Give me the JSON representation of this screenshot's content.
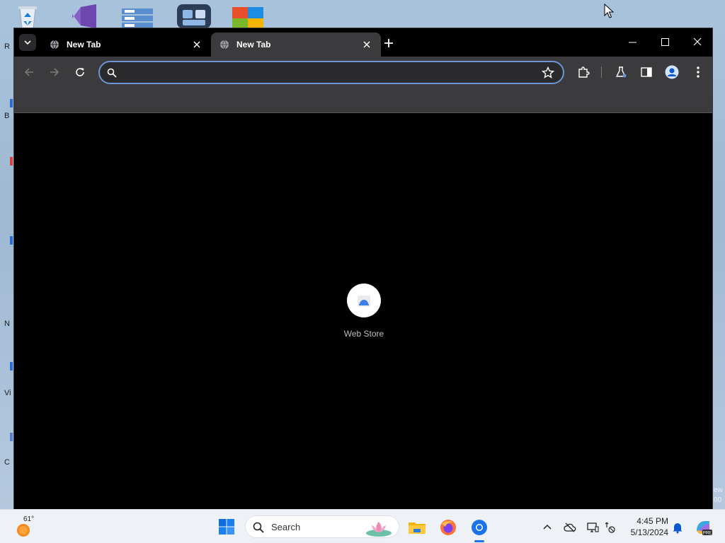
{
  "desktop": {
    "left_letters": [
      "R",
      "B",
      "N",
      "Vi",
      "C"
    ]
  },
  "browser": {
    "tabs": [
      {
        "title": "New Tab",
        "active": false
      },
      {
        "title": "New Tab",
        "active": true
      }
    ],
    "omnibox": {
      "value": "",
      "placeholder": ""
    },
    "shortcuts": [
      {
        "label": "Web Store"
      }
    ]
  },
  "right_peek": [
    "ew",
    "00"
  ],
  "taskbar": {
    "weather_temp": "61°",
    "search_label": "Search",
    "clock_time": "4:45 PM",
    "clock_date": "5/13/2024"
  },
  "colors": {
    "omnibox_border": "#6c95d6",
    "toolbar_bg": "#3b3b3d",
    "content_bg": "#000000",
    "accent": "#1a73e8"
  }
}
